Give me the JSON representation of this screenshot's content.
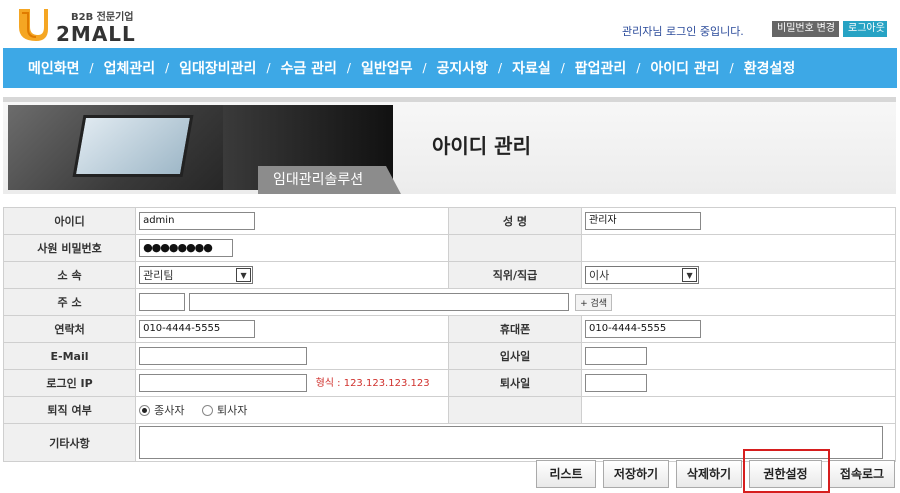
{
  "header": {
    "logo": {
      "tagline": "B2B 전문기업",
      "brand": "2MALL"
    },
    "login_message": "관리자님 로그인 중입니다.",
    "change_password_label": "비밀번호 변경",
    "logout_label": "로그아웃"
  },
  "nav": {
    "items": [
      "메인화면",
      "업체관리",
      "임대장비관리",
      "수금 관리",
      "일반업무",
      "공지사항",
      "자료실",
      "팝업관리",
      "아이디 관리",
      "환경설정"
    ],
    "separator": "/"
  },
  "banner": {
    "solution_label": "임대관리솔루션",
    "page_title": "아이디 관리"
  },
  "form": {
    "id_label": "아이디",
    "id_value": "admin",
    "name_label": "성 명",
    "name_value": "관리자",
    "password_label": "사원 비밀번호",
    "password_value": "●●●●●●●●",
    "dept_label": "소 속",
    "dept_value": "관리팀",
    "position_label": "직위/직급",
    "position_value": "이사",
    "address_label": "주 소",
    "address_search_label": "+ 검색",
    "phone_label": "연락처",
    "phone_value": "010-4444-5555",
    "mobile_label": "휴대폰",
    "mobile_value": "010-4444-5555",
    "email_label": "E-Mail",
    "email_value": "",
    "join_date_label": "입사일",
    "join_date_value": "",
    "login_ip_label": "로그인 IP",
    "login_ip_value": "",
    "login_ip_hint": "형식 : 123.123.123.123",
    "leave_date_label": "퇴사일",
    "leave_date_value": "",
    "status_label": "퇴직 여부",
    "status_options": [
      "종사자",
      "퇴사자"
    ],
    "status_selected": "종사자",
    "memo_label": "기타사항",
    "memo_value": ""
  },
  "actions": {
    "list_label": "리스트",
    "save_label": "저장하기",
    "delete_label": "삭제하기",
    "permission_label": "권한설정",
    "access_log_label": "접속로그"
  },
  "colors": {
    "nav_bg": "#3da8e6",
    "logout_bg": "#27a3c4",
    "hint_red": "#d0312d",
    "highlight": "#d61e1e",
    "label_bg": "#f0f0f0"
  }
}
